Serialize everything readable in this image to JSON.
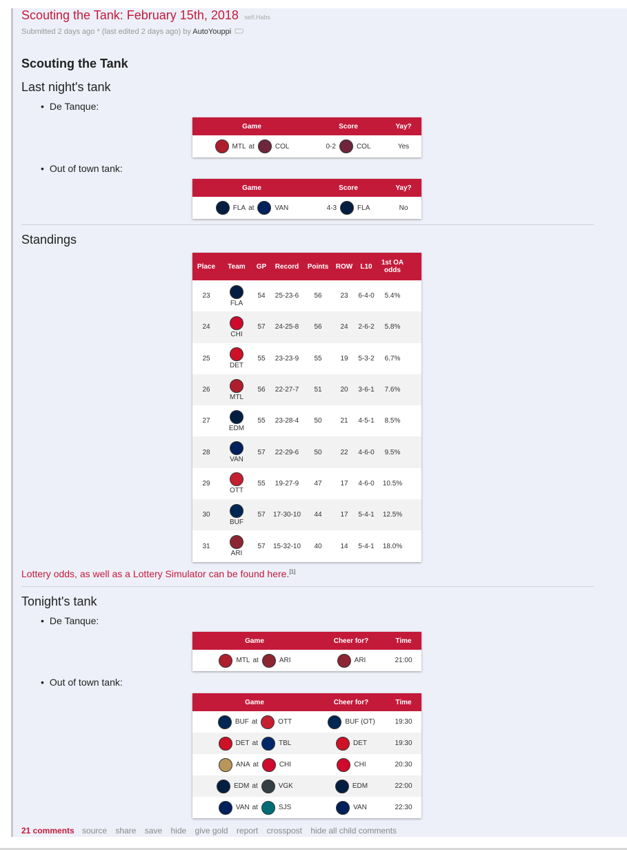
{
  "post": {
    "title": "Scouting the Tank: February 15th, 2018",
    "domain": "self.Habs",
    "submitted": "Submitted 2 days ago * (last edited 2 days ago) by",
    "author": "AutoYouppi"
  },
  "headings": {
    "main": "Scouting the Tank",
    "last_night": "Last night's tank",
    "standings": "Standings",
    "tonight": "Tonight's tank"
  },
  "bullets": {
    "de_tanque_1": "De Tanque:",
    "out_of_town_1": "Out of town tank:",
    "de_tanque_2": "De Tanque:",
    "out_of_town_2": "Out of town tank:"
  },
  "colors": {
    "accent": "#c41a3a",
    "MTL": "#af1e2d",
    "COL": "#6f263d",
    "FLA": "#041e42",
    "VAN": "#00205b",
    "CHI": "#cf0a2c",
    "DET": "#ce1126",
    "EDM": "#041e42",
    "OTT": "#c52032",
    "BUF": "#002654",
    "ARI": "#8c2633",
    "TBL": "#002868",
    "ANA": "#b9975b",
    "VGK": "#333f42",
    "SJS": "#006d75"
  },
  "last_night_de_tanque": {
    "headers": [
      "Game",
      "Score",
      "Yay?"
    ],
    "rows": [
      {
        "away": "MTL",
        "at": "at",
        "home": "COL",
        "score": "0-2",
        "winner": "COL",
        "yay": "Yes"
      }
    ]
  },
  "last_night_out_of_town": {
    "headers": [
      "Game",
      "Score",
      "Yay?"
    ],
    "rows": [
      {
        "away": "FLA",
        "at": "at",
        "home": "VAN",
        "score": "4-3",
        "winner": "FLA",
        "yay": "No"
      }
    ]
  },
  "standings": {
    "headers": [
      "Place",
      "Team",
      "GP",
      "Record",
      "Points",
      "ROW",
      "L10",
      "1st OA odds"
    ],
    "rows": [
      {
        "place": "23",
        "team": "FLA",
        "gp": "54",
        "record": "25-23-6",
        "points": "56",
        "row": "23",
        "l10": "6-4-0",
        "odds": "5.4%"
      },
      {
        "place": "24",
        "team": "CHI",
        "gp": "57",
        "record": "24-25-8",
        "points": "56",
        "row": "24",
        "l10": "2-6-2",
        "odds": "5.8%"
      },
      {
        "place": "25",
        "team": "DET",
        "gp": "55",
        "record": "23-23-9",
        "points": "55",
        "row": "19",
        "l10": "5-3-2",
        "odds": "6.7%"
      },
      {
        "place": "26",
        "team": "MTL",
        "gp": "56",
        "record": "22-27-7",
        "points": "51",
        "row": "20",
        "l10": "3-6-1",
        "odds": "7.6%"
      },
      {
        "place": "27",
        "team": "EDM",
        "gp": "55",
        "record": "23-28-4",
        "points": "50",
        "row": "21",
        "l10": "4-5-1",
        "odds": "8.5%"
      },
      {
        "place": "28",
        "team": "VAN",
        "gp": "57",
        "record": "22-29-6",
        "points": "50",
        "row": "22",
        "l10": "4-6-0",
        "odds": "9.5%"
      },
      {
        "place": "29",
        "team": "OTT",
        "gp": "55",
        "record": "19-27-9",
        "points": "47",
        "row": "17",
        "l10": "4-6-0",
        "odds": "10.5%"
      },
      {
        "place": "30",
        "team": "BUF",
        "gp": "57",
        "record": "17-30-10",
        "points": "44",
        "row": "17",
        "l10": "5-4-1",
        "odds": "12.5%"
      },
      {
        "place": "31",
        "team": "ARI",
        "gp": "57",
        "record": "15-32-10",
        "points": "40",
        "row": "14",
        "l10": "5-4-1",
        "odds": "18.0%"
      }
    ]
  },
  "lottery": {
    "text": "Lottery odds, as well as a Lottery Simulator can be found here.",
    "ref": "[1]"
  },
  "tonight_de_tanque": {
    "headers": [
      "Game",
      "Cheer for?",
      "Time"
    ],
    "rows": [
      {
        "away": "MTL",
        "at": "at",
        "home": "ARI",
        "cheer_team": "ARI",
        "cheer": "ARI",
        "time": "21:00"
      }
    ]
  },
  "tonight_out_of_town": {
    "headers": [
      "Game",
      "Cheer for?",
      "Time"
    ],
    "rows": [
      {
        "away": "BUF",
        "at": "at",
        "home": "OTT",
        "cheer_team": "BUF",
        "cheer": "BUF (OT)",
        "time": "19:30"
      },
      {
        "away": "DET",
        "at": "at",
        "home": "TBL",
        "cheer_team": "DET",
        "cheer": "DET",
        "time": "19:30"
      },
      {
        "away": "ANA",
        "at": "at",
        "home": "CHI",
        "cheer_team": "CHI",
        "cheer": "CHI",
        "time": "20:30"
      },
      {
        "away": "EDM",
        "at": "at",
        "home": "VGK",
        "cheer_team": "EDM",
        "cheer": "EDM",
        "time": "22:00"
      },
      {
        "away": "VAN",
        "at": "at",
        "home": "SJS",
        "cheer_team": "VAN",
        "cheer": "VAN",
        "time": "22:30"
      }
    ]
  },
  "footer": {
    "comments": "21 comments",
    "links": [
      "source",
      "share",
      "save",
      "hide",
      "give gold",
      "report",
      "crosspost",
      "hide all child comments"
    ]
  }
}
